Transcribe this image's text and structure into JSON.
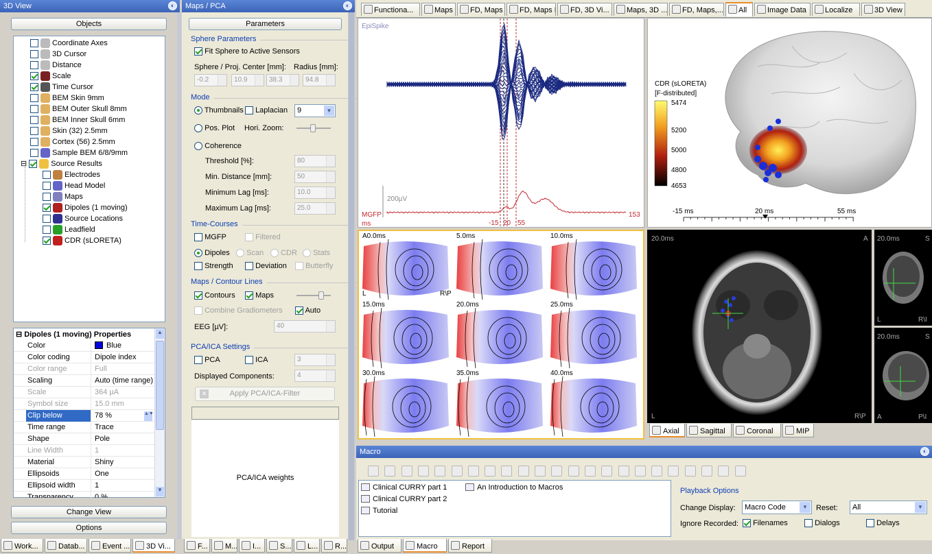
{
  "left_panel": {
    "title": "3D View",
    "objects_button": "Objects",
    "tree": [
      {
        "label": "Coordinate Axes",
        "checked": false
      },
      {
        "label": "3D Cursor",
        "checked": false
      },
      {
        "label": "Distance",
        "checked": false
      },
      {
        "label": "Scale",
        "checked": true
      },
      {
        "label": "Time Cursor",
        "checked": true
      },
      {
        "label": "BEM Skin 9mm",
        "checked": false
      },
      {
        "label": "BEM Outer Skull 8mm",
        "checked": false
      },
      {
        "label": "BEM Inner Skull 6mm",
        "checked": false
      },
      {
        "label": "Skin (32) 2.5mm",
        "checked": false
      },
      {
        "label": "Cortex (56) 2.5mm",
        "checked": false
      },
      {
        "label": "Sample BEM 6/8/9mm",
        "checked": false
      },
      {
        "label": "Source Results",
        "checked": true
      },
      {
        "label": "Electrodes",
        "checked": false
      },
      {
        "label": "Head Model",
        "checked": false
      },
      {
        "label": "Maps",
        "checked": false
      },
      {
        "label": "Dipoles (1 moving)",
        "checked": true
      },
      {
        "label": "Source Locations",
        "checked": false
      },
      {
        "label": "Leadfield",
        "checked": false
      },
      {
        "label": "CDR (sLORETA)",
        "checked": true
      }
    ],
    "props_title": "Dipoles (1 moving) Properties",
    "props": [
      {
        "k": "Color",
        "v": "Blue",
        "dis": false
      },
      {
        "k": "Color coding",
        "v": "Dipole index",
        "dis": false
      },
      {
        "k": "Color range",
        "v": "Full",
        "dis": true
      },
      {
        "k": "Scaling",
        "v": "Auto (time range)",
        "dis": false
      },
      {
        "k": "Scale",
        "v": "364 µA",
        "dis": true
      },
      {
        "k": "Symbol size",
        "v": "15.0 mm",
        "dis": true
      },
      {
        "k": "Clip below",
        "v": "78 %",
        "dis": false
      },
      {
        "k": "Time range",
        "v": "Trace",
        "dis": false
      },
      {
        "k": "Shape",
        "v": "Pole",
        "dis": false
      },
      {
        "k": "Line Width",
        "v": "1",
        "dis": true
      },
      {
        "k": "Material",
        "v": "Shiny",
        "dis": false
      },
      {
        "k": "Ellipsoids",
        "v": "One",
        "dis": false
      },
      {
        "k": "Ellipsoid width",
        "v": "1",
        "dis": false
      },
      {
        "k": "Transparency",
        "v": "0 %",
        "dis": false
      }
    ],
    "change_view": "Change View",
    "options": "Options",
    "bottom_tabs": [
      "Work...",
      "Datab...",
      "Event ...",
      "3D Vi..."
    ]
  },
  "mid_panel": {
    "title": "Maps / PCA",
    "params_button": "Parameters",
    "sphere_header": "Sphere Parameters",
    "fit_sphere": "Fit Sphere to Active Sensors",
    "center_label": "Sphere / Proj. Center [mm]:",
    "radius_label": "Radius [mm]:",
    "center_vals": [
      "-0.2",
      "10.9",
      "38.3"
    ],
    "radius_val": "94.8",
    "mode_header": "Mode",
    "thumbnails": "Thumbnails",
    "laplacian": "Laplacian",
    "thumb_count": "9",
    "pos_plot": "Pos. Plot",
    "hori_zoom": "Hori. Zoom:",
    "coherence": "Coherence",
    "threshold": "Threshold [%]:",
    "threshold_v": "80",
    "min_dist": "Min. Distance [mm]:",
    "min_dist_v": "50",
    "min_lag": "Minimum Lag [ms]:",
    "min_lag_v": "10.0",
    "max_lag": "Maximum Lag [ms]:",
    "max_lag_v": "25.0",
    "tc_header": "Time-Courses",
    "mgfp": "MGFP",
    "filtered": "Filtered",
    "dipoles": "Dipoles",
    "scan": "Scan",
    "cdr": "CDR",
    "stats": "Stats",
    "strength": "Strength",
    "deviation": "Deviation",
    "butterfly": "Butterfly",
    "maps_header": "Maps / Contour Lines",
    "contours": "Contours",
    "maps": "Maps",
    "combine": "Combine Gradiometers",
    "auto": "Auto",
    "eeg": "EEG [µV]:",
    "eeg_v": "40",
    "pca_header": "PCA/ICA Settings",
    "pca": "PCA",
    "ica": "ICA",
    "ica_v": "3",
    "disp_comp": "Displayed Components:",
    "disp_comp_v": "4",
    "apply": "Apply PCA/ICA-Filter",
    "weights": "PCA/ICA weights",
    "bottom_tabs": [
      "F...",
      "M...",
      "I...",
      "S...",
      "L...",
      "R..."
    ]
  },
  "top_tabs": [
    "Functiona...",
    "Maps",
    "FD, Maps",
    "FD, Maps H",
    "FD, 3D Vi...",
    "Maps, 3D ...",
    "FD, Maps,...",
    "All",
    "Image Data",
    "Localize",
    "3D View"
  ],
  "waveform": {
    "label": "EpiSpike",
    "scale": "200µV",
    "mgfp": "MGFP",
    "ms": "ms",
    "ticks": [
      "-15",
      "20",
      "55"
    ],
    "end_val": "153"
  },
  "cdr": {
    "title": "CDR (sLORETA)",
    "subtitle": "[F-distributed]",
    "scale": [
      "5474",
      "5200",
      "5000",
      "4800",
      "4653"
    ],
    "axis": [
      "-15 ms",
      "20 ms",
      "55 ms"
    ]
  },
  "maps_grid": [
    {
      "t": "0.0ms",
      "extra": "A"
    },
    {
      "t": "5.0ms",
      "extra": ""
    },
    {
      "t": "10.0ms",
      "extra": ""
    },
    {
      "t": "15.0ms",
      "extra": ""
    },
    {
      "t": "20.0ms",
      "extra": ""
    },
    {
      "t": "25.0ms",
      "extra": ""
    },
    {
      "t": "30.0ms",
      "extra": ""
    },
    {
      "t": "35.0ms",
      "extra": ""
    },
    {
      "t": "40.0ms",
      "extra": ""
    }
  ],
  "map_labels": {
    "l": "L",
    "rp": "R\\P"
  },
  "mri": {
    "axial_time": "20.0ms",
    "axial_a": "A",
    "axial_l": "L",
    "axial_rp": "R\\P",
    "cor_time": "20.0ms",
    "cor_s": "S",
    "cor_l": "L",
    "cor_rv": "R\\I",
    "sag_time": "20.0ms",
    "sag_s": "S",
    "sag_a": "A",
    "sag_pv": "P\\I",
    "tabs": [
      "Axial",
      "Sagittal",
      "Coronal",
      "MIP"
    ]
  },
  "macro": {
    "title": "Macro",
    "items": [
      "Clinical CURRY part 1",
      "Clinical CURRY part 2",
      "Tutorial"
    ],
    "item2": "An Introduction to Macros",
    "playback": "Playback Options",
    "change_display": "Change Display:",
    "change_display_v": "Macro Code",
    "reset": "Reset:",
    "reset_v": "All",
    "ignore": "Ignore Recorded:",
    "filenames": "Filenames",
    "dialogs": "Dialogs",
    "delays": "Delays",
    "bottom_tabs": [
      "Output",
      "Macro",
      "Report"
    ]
  },
  "colors": {
    "accent": "#e68b2c",
    "title_blue": "#3c63b8",
    "mgfp_red": "#c0282d",
    "trace_blue": "#1b2a80"
  }
}
